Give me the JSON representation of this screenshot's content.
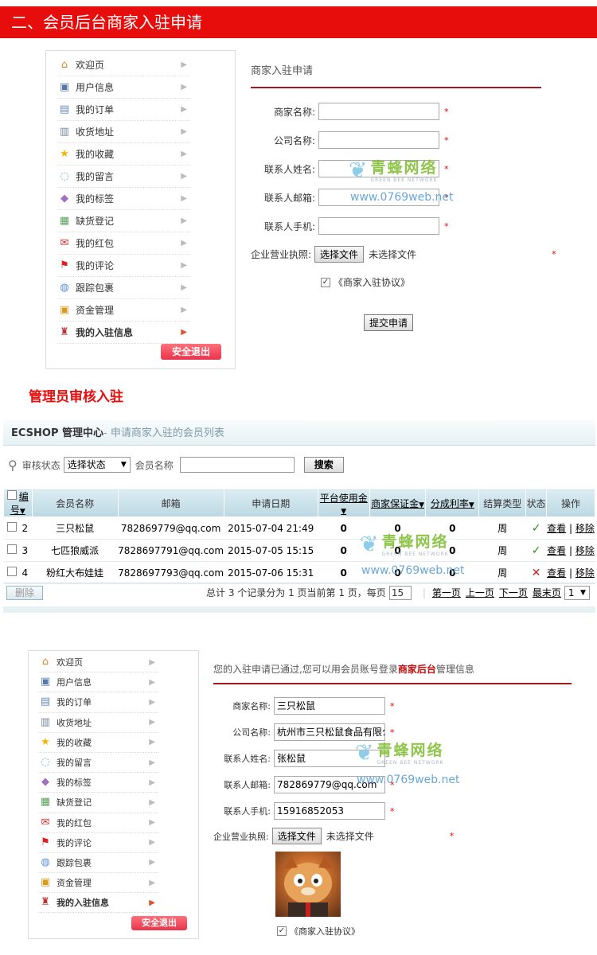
{
  "banner": {
    "title": "二、会员后台商家入驻申请"
  },
  "section1": {
    "sidebar": [
      {
        "label": "欢迎页",
        "icon": "home-icon",
        "glyph": "⌂",
        "color": "#d9892a"
      },
      {
        "label": "用户信息",
        "icon": "id-card-icon",
        "glyph": "▣",
        "color": "#5577aa"
      },
      {
        "label": "我的订单",
        "icon": "document-icon",
        "glyph": "▤",
        "color": "#6688bb"
      },
      {
        "label": "收货地址",
        "icon": "address-book-icon",
        "glyph": "▥",
        "color": "#778899"
      },
      {
        "label": "我的收藏",
        "icon": "star-icon",
        "glyph": "★",
        "color": "#f2b800"
      },
      {
        "label": "我的留言",
        "icon": "speech-bubble-icon",
        "glyph": "◌",
        "color": "#6fa8d8"
      },
      {
        "label": "我的标签",
        "icon": "tag-icon",
        "glyph": "◆",
        "color": "#a070c0"
      },
      {
        "label": "缺货登记",
        "icon": "clipboard-icon",
        "glyph": "▦",
        "color": "#5f9f5f"
      },
      {
        "label": "我的红包",
        "icon": "red-envelope-icon",
        "glyph": "✉",
        "color": "#d33030"
      },
      {
        "label": "我的评论",
        "icon": "flag-icon",
        "glyph": "⚑",
        "color": "#e02020"
      },
      {
        "label": "跟踪包裹",
        "icon": "package-icon",
        "glyph": "◍",
        "color": "#5c8fd0"
      },
      {
        "label": "资金管理",
        "icon": "wallet-icon",
        "glyph": "▣",
        "color": "#d99a20"
      },
      {
        "label": "我的入驻信息",
        "icon": "shop-icon",
        "glyph": "♜",
        "color": "#c03030"
      }
    ],
    "logout": "安全退出",
    "form_title": "商家入驻申请",
    "fields": [
      {
        "label": "商家名称:",
        "value": ""
      },
      {
        "label": "公司名称:",
        "value": ""
      },
      {
        "label": "联系人姓名:",
        "value": ""
      },
      {
        "label": "联系人邮箱:",
        "value": ""
      },
      {
        "label": "联系人手机:",
        "value": ""
      }
    ],
    "license_label": "企业营业执照:",
    "file_button": "选择文件",
    "file_none": "未选择文件",
    "agreement": "《商家入驻协议》",
    "submit": "提交申请",
    "required_mark": "*"
  },
  "section2": {
    "title": "管理员审核入驻",
    "header_app": "ECSHOP 管理中心",
    "header_page": "- 申请商家入驻的会员列表",
    "filter_label": "审核状态",
    "filter_value": "选择状态",
    "member_label": "会员名称",
    "search_button": "搜索",
    "columns": [
      "编号",
      "会员名称",
      "邮箱",
      "申请日期",
      "平台使用金",
      "商家保证金",
      "分成利率",
      "结算类型",
      "状态",
      "操作"
    ],
    "rows": [
      {
        "id": "2",
        "name": "三只松鼠",
        "email": "782869779@qq.com",
        "date": "2015-07-04 21:49",
        "fee": "0",
        "deposit": "0",
        "rate": "0",
        "settle": "周",
        "status": "approved",
        "view": "查看",
        "remove": "移除"
      },
      {
        "id": "3",
        "name": "七匹狼威派",
        "email": "7828697791@qq.com",
        "date": "2015-07-05 15:15",
        "fee": "0",
        "deposit": "0",
        "rate": "0",
        "settle": "周",
        "status": "approved",
        "view": "查看",
        "remove": "移除"
      },
      {
        "id": "4",
        "name": "粉红大布娃娃",
        "email": "7828697793@qq.com",
        "date": "2015-07-06 15:31",
        "fee": "0",
        "deposit": "0",
        "rate": "0",
        "settle": "周",
        "status": "rejected",
        "view": "查看",
        "remove": "移除"
      }
    ],
    "delete_button": "删除",
    "pager": {
      "summary": "总计  3 个记录分为  1 页当前第  1 页，每页",
      "per_page": "15",
      "first": "第一页",
      "prev": "上一页",
      "next": "下一页",
      "last": "最末页",
      "page": "1"
    },
    "status_marks": {
      "approved": "✓",
      "rejected": "✕"
    },
    "status_colors": {
      "approved": "#2e8b1f",
      "rejected": "#d01818"
    }
  },
  "section3": {
    "notice_before": "您的入驻申请已通过,您可以用会员账号登录",
    "notice_link": "商家后台",
    "notice_after": "管理信息",
    "fields": [
      {
        "label": "商家名称:",
        "value": "三只松鼠"
      },
      {
        "label": "公司名称:",
        "value": "杭州市三只松鼠食品有限公"
      },
      {
        "label": "联系人姓名:",
        "value": "张松鼠"
      },
      {
        "label": "联系人邮箱:",
        "value": "782869779@qq.com"
      },
      {
        "label": "联系人手机:",
        "value": "15916852053"
      }
    ]
  },
  "watermark": {
    "cn": "青蜂网络",
    "en": "GREEN BEE NETWORK",
    "url": "www.0769web.net"
  },
  "colors": {
    "brand_red": "#e80d0d",
    "rule": "#a0191e",
    "admin_header": "#e6f1f4"
  }
}
